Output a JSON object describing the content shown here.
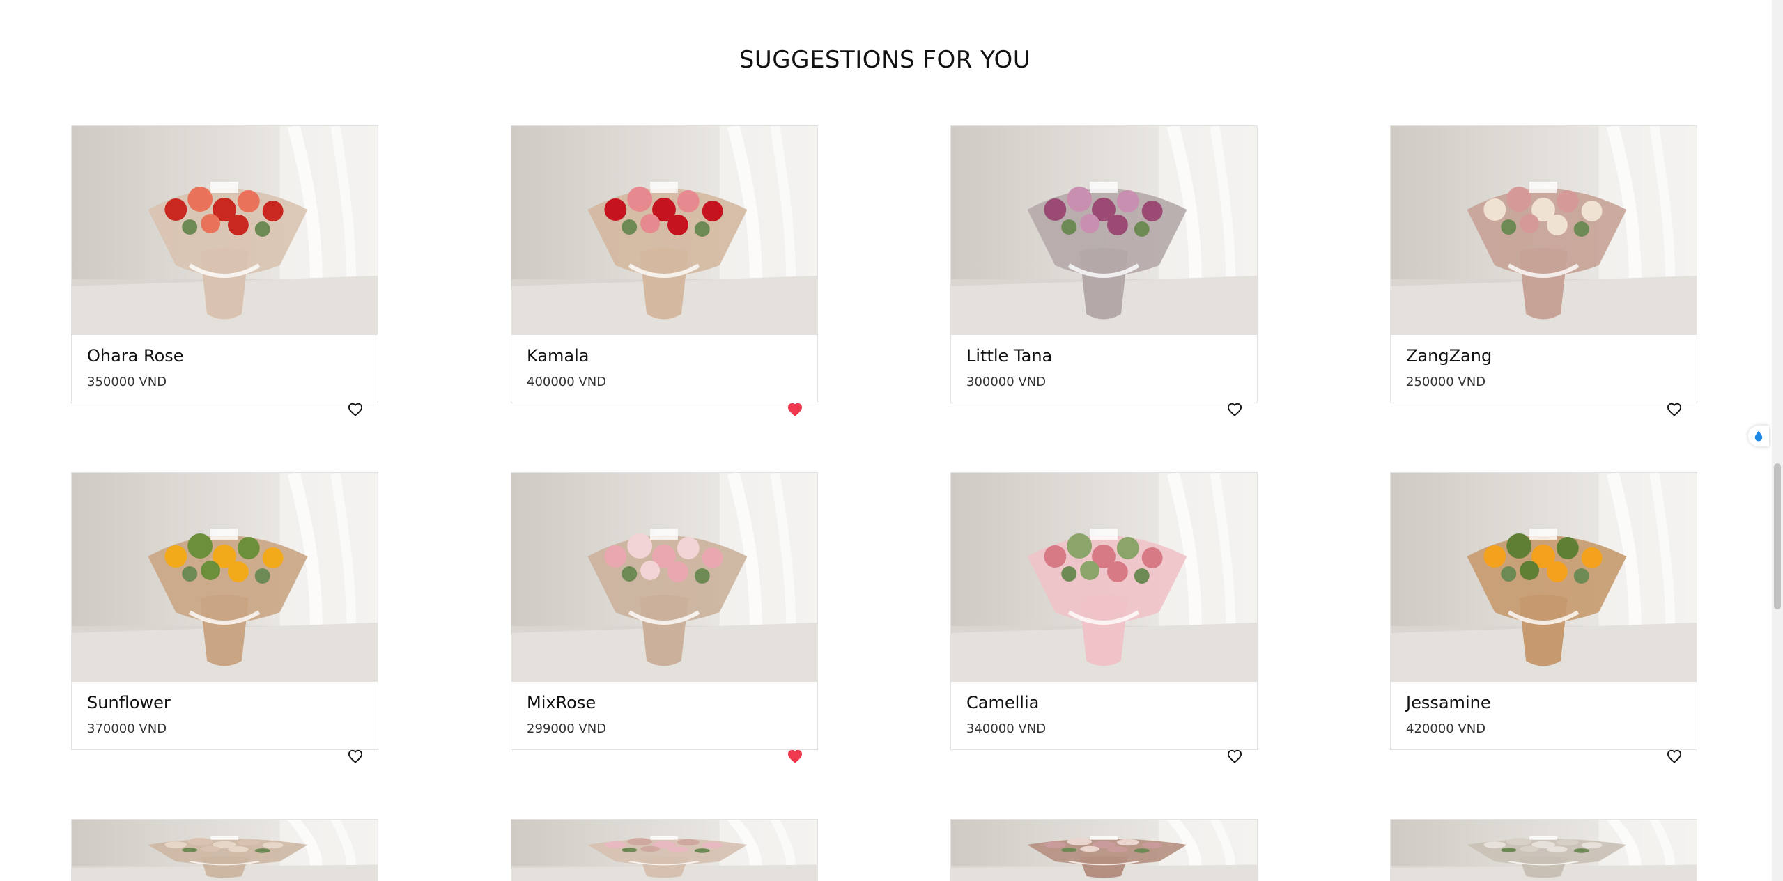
{
  "section": {
    "title": "SUGGESTIONS FOR YOU"
  },
  "products": [
    {
      "name": "Ohara Rose",
      "price": "350000 VND",
      "favorite": false,
      "palette": [
        "#c8281f",
        "#e9735a",
        "#d9c3b0"
      ]
    },
    {
      "name": "Kamala",
      "price": "400000 VND",
      "favorite": true,
      "palette": [
        "#c5131f",
        "#e68a8f",
        "#d4b8a0"
      ]
    },
    {
      "name": "Little Tana",
      "price": "300000 VND",
      "favorite": false,
      "palette": [
        "#9a4a73",
        "#c98fb0",
        "#b5a8a8"
      ]
    },
    {
      "name": "ZangZang",
      "price": "250000 VND",
      "favorite": false,
      "palette": [
        "#f0e2d3",
        "#d59a98",
        "#c7a296"
      ]
    },
    {
      "name": "Sunflower",
      "price": "370000 VND",
      "favorite": false,
      "palette": [
        "#f2a91a",
        "#6b8f3a",
        "#caa584"
      ]
    },
    {
      "name": "MixRose",
      "price": "299000 VND",
      "favorite": true,
      "palette": [
        "#e9a8b0",
        "#f3d4d6",
        "#cbb19b"
      ]
    },
    {
      "name": "Camellia",
      "price": "340000 VND",
      "favorite": false,
      "palette": [
        "#d87a86",
        "#8aa46a",
        "#f0c3c8"
      ]
    },
    {
      "name": "Jessamine",
      "price": "420000 VND",
      "favorite": false,
      "palette": [
        "#f4a21d",
        "#5f7f35",
        "#c69a6e"
      ]
    }
  ],
  "colors": {
    "heart_active": "#f0384f",
    "heart_inactive": "#111111",
    "background": "#ffffff"
  },
  "icons": {
    "favorite": "heart-icon",
    "widget": "droplet-icon"
  }
}
